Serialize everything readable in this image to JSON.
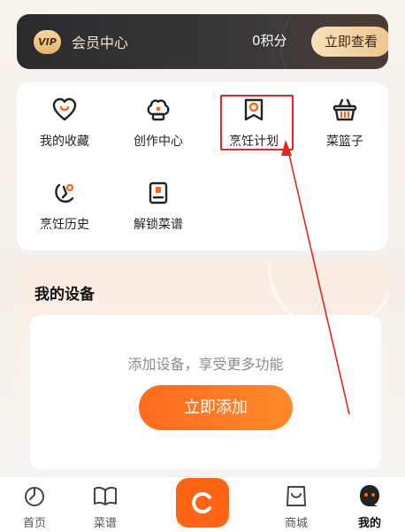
{
  "vip": {
    "badge": "VIP",
    "title": "会员中心",
    "points": "0积分",
    "button": "立即查看"
  },
  "grid": {
    "items": [
      {
        "label": "我的收藏",
        "icon": "favorite-icon"
      },
      {
        "label": "创作中心",
        "icon": "chef-hat-icon"
      },
      {
        "label": "烹饪计划",
        "icon": "cooking-plan-icon"
      },
      {
        "label": "菜篮子",
        "icon": "basket-icon"
      },
      {
        "label": "烹饪历史",
        "icon": "history-icon"
      },
      {
        "label": "解锁菜谱",
        "icon": "unlock-recipe-icon"
      }
    ]
  },
  "devices": {
    "title": "我的设备",
    "hint": "添加设备，享受更多功能",
    "add_button": "立即添加"
  },
  "tabbar": {
    "items": [
      {
        "label": "首页",
        "icon": "home-icon",
        "active": false
      },
      {
        "label": "菜谱",
        "icon": "recipe-book-icon",
        "active": false
      },
      {
        "label": "",
        "icon": "refresh-icon",
        "active": false
      },
      {
        "label": "商城",
        "icon": "shopping-bag-icon",
        "active": false
      },
      {
        "label": "我的",
        "icon": "profile-icon",
        "active": true
      }
    ]
  },
  "colors": {
    "accent": "#ff6415",
    "highlight": "#e8231e",
    "vip_bg": "#2b2b2e",
    "vip_gold": "#efc58c"
  }
}
